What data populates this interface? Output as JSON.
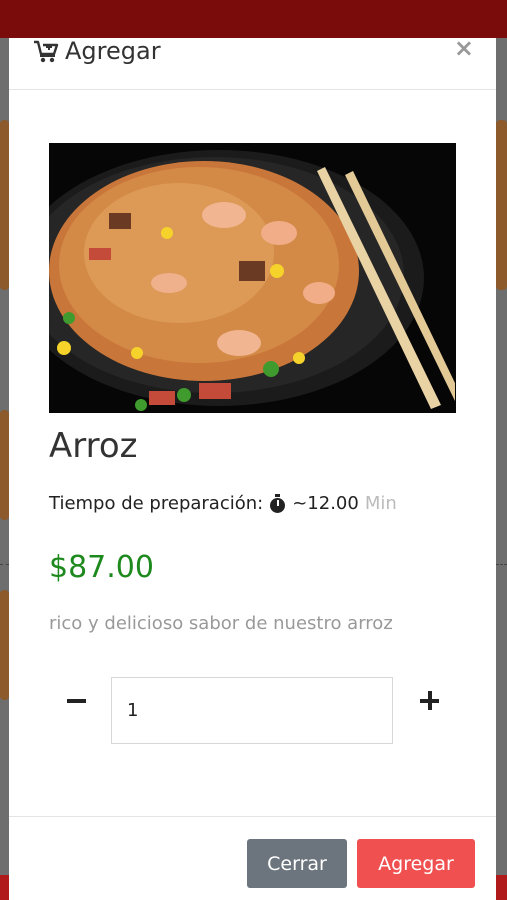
{
  "modal": {
    "title": "Agregar",
    "close_symbol": "×",
    "title_icon": "cart-plus-icon",
    "image_alt": "Arroz frito con camarones y palillos"
  },
  "product": {
    "name": "Arroz",
    "prep_label": "Tiempo de preparación:",
    "prep_icon": "stopwatch-icon",
    "prep_value": "~12.00",
    "prep_unit": "Min",
    "price": "$87.00",
    "price_color": "#1e8a1e",
    "description": "rico y delicioso sabor de nuestro arroz"
  },
  "quantity": {
    "value": "1",
    "minus_icon": "minus-icon",
    "plus_icon": "plus-icon"
  },
  "footer": {
    "close_label": "Cerrar",
    "add_label": "Agregar",
    "close_color": "#6c757d",
    "add_color": "#f05050"
  }
}
